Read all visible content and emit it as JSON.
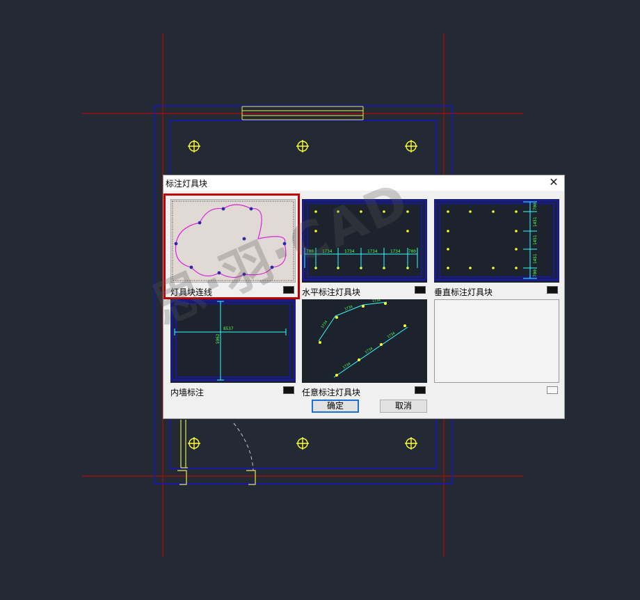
{
  "dialog": {
    "title": "标注灯具块",
    "close_glyph": "✕",
    "tiles": [
      {
        "label": "灯具块连线",
        "selected": true
      },
      {
        "label": "水平标注灯具块"
      },
      {
        "label": "垂直标注灯具块"
      },
      {
        "label": "内墙标注"
      },
      {
        "label": "任意标注灯具块"
      },
      {
        "label": ""
      }
    ],
    "ok_label": "确定",
    "cancel_label": "取消"
  },
  "thumbnails": {
    "horizontal_dims": [
      "700",
      "1734",
      "1734",
      "1734",
      "1734",
      "700"
    ],
    "vertical_dims": [
      "700",
      "1451",
      "1451",
      "1451",
      "700"
    ],
    "wall_width": "8537",
    "wall_height": "5962",
    "arbitrary_dims": [
      "1734",
      "1734",
      "1734",
      "1734",
      "1734",
      "1734",
      "1734"
    ]
  },
  "watermark": "思·羽·CAD",
  "colors": {
    "canvas": "#232a33",
    "outline_blue": "#1414c8",
    "axis_red": "#d00000",
    "lamp_yellow": "#ffff33",
    "dim_cyan": "#33ffff",
    "dim_green": "#55ff55",
    "polyline_magenta": "#dd22dd",
    "selection_red": "#c00000"
  }
}
